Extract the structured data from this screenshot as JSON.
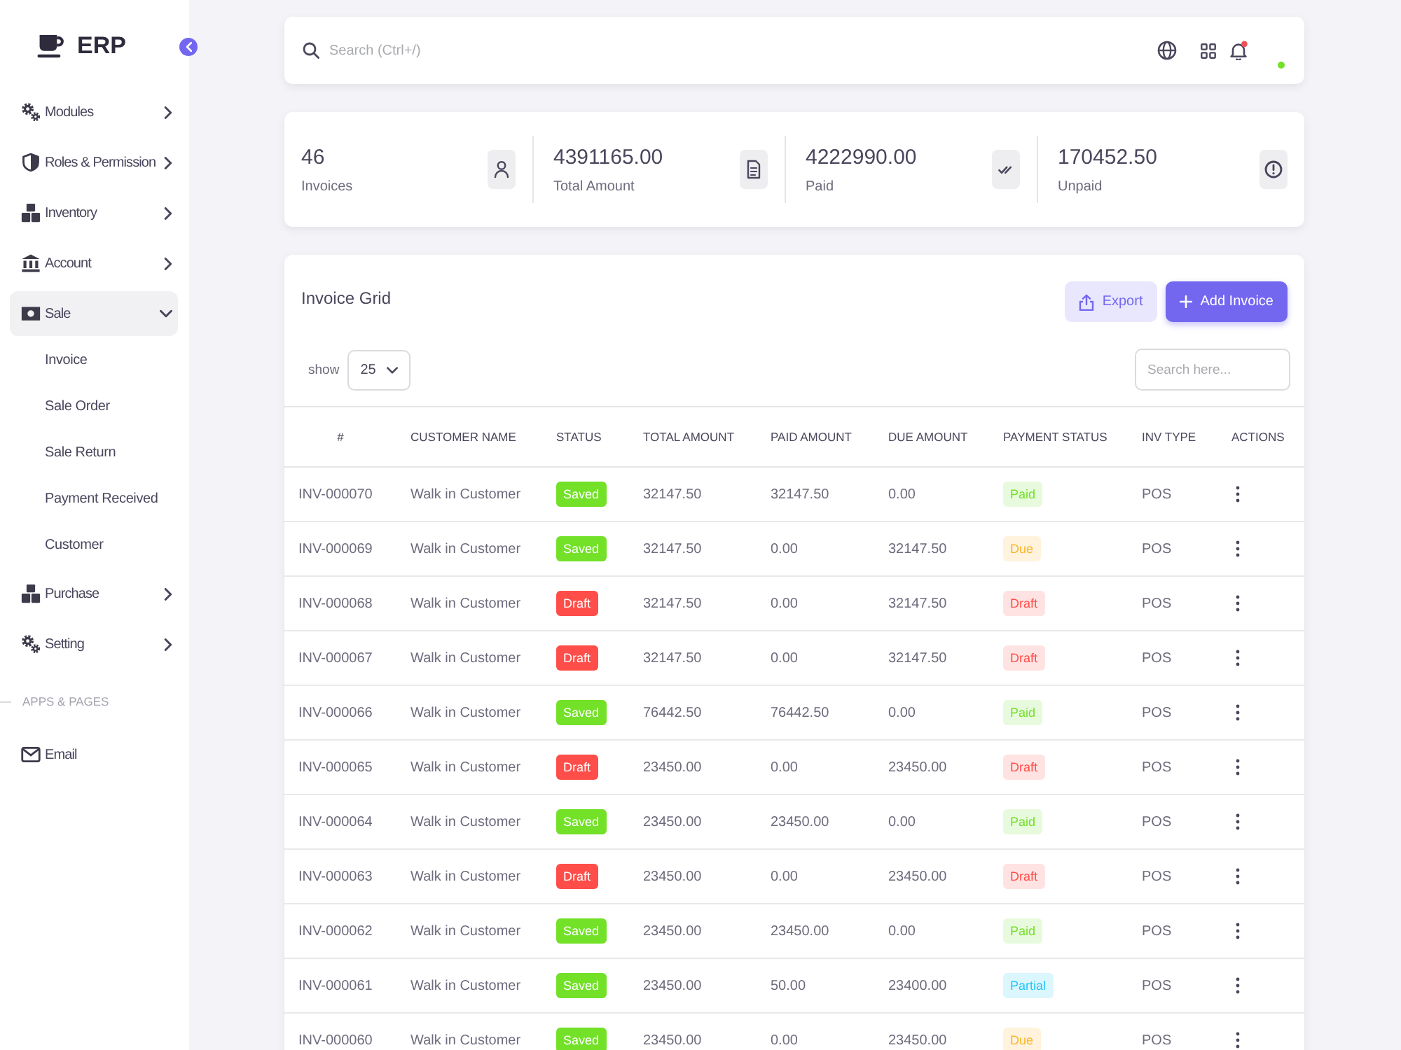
{
  "sidebar": {
    "logo": "ERP",
    "menu": [
      {
        "label": "Modules",
        "expanded": false
      },
      {
        "label": "Roles & Permission",
        "expanded": false
      },
      {
        "label": "Inventory",
        "expanded": false
      },
      {
        "label": "Account",
        "expanded": false
      },
      {
        "label": "Sale",
        "expanded": true,
        "children": [
          {
            "label": "Invoice"
          },
          {
            "label": "Sale Order"
          },
          {
            "label": "Sale Return"
          },
          {
            "label": "Payment Received"
          },
          {
            "label": "Customer"
          }
        ]
      },
      {
        "label": "Purchase",
        "expanded": false
      },
      {
        "label": "Setting",
        "expanded": false
      }
    ],
    "sections": [
      {
        "title": "APPS & PAGES",
        "items": [
          {
            "label": "Email"
          }
        ]
      }
    ]
  },
  "topbar": {
    "search": {
      "placeholder": "Search (Ctrl+/)"
    }
  },
  "stats": [
    {
      "value": "46",
      "label": "Invoices"
    },
    {
      "value": "4391165.00",
      "label": "Total Amount"
    },
    {
      "value": "4222990.00",
      "label": "Paid"
    },
    {
      "value": "170452.50",
      "label": "Unpaid"
    }
  ],
  "invoice_grid": {
    "title": "Invoice Grid",
    "buttons": [
      {
        "label": "Export",
        "kind": "secondary"
      },
      {
        "label": "Add Invoice",
        "kind": "primary"
      }
    ],
    "page_size": {
      "label": "show",
      "value": "25"
    },
    "search": {
      "placeholder": "Search here..."
    },
    "table": {
      "columns": [
        "#",
        "CUSTOMER NAME",
        "STATUS",
        "TOTAL AMOUNT",
        "PAID AMOUNT",
        "DUE AMOUNT",
        "PAYMENT STATUS",
        "INV TYPE",
        "ACTIONS"
      ],
      "rows": [
        {
          "number": "INV-000070",
          "customer": "Walk in Customer",
          "status": {
            "text": "Saved",
            "color": "#72e128"
          },
          "total": "32147.50",
          "paid": "32147.50",
          "due": "0.00",
          "payment_status": {
            "text": "Paid",
            "color": "#72e128"
          },
          "inv_type": "POS"
        },
        {
          "number": "INV-000069",
          "customer": "Walk in Customer",
          "status": {
            "text": "Saved",
            "color": "#72e128"
          },
          "total": "32147.50",
          "paid": "0.00",
          "due": "32147.50",
          "payment_status": {
            "text": "Due",
            "color": "#fdb528"
          },
          "inv_type": "POS"
        },
        {
          "number": "INV-000068",
          "customer": "Walk in Customer",
          "status": {
            "text": "Draft",
            "color": "#ff4d49"
          },
          "total": "32147.50",
          "paid": "0.00",
          "due": "32147.50",
          "payment_status": {
            "text": "Draft",
            "color": "#ff4d49"
          },
          "inv_type": "POS"
        },
        {
          "number": "INV-000067",
          "customer": "Walk in Customer",
          "status": {
            "text": "Draft",
            "color": "#ff4d49"
          },
          "total": "32147.50",
          "paid": "0.00",
          "due": "32147.50",
          "payment_status": {
            "text": "Draft",
            "color": "#ff4d49"
          },
          "inv_type": "POS"
        },
        {
          "number": "INV-000066",
          "customer": "Walk in Customer",
          "status": {
            "text": "Saved",
            "color": "#72e128"
          },
          "total": "76442.50",
          "paid": "76442.50",
          "due": "0.00",
          "payment_status": {
            "text": "Paid",
            "color": "#72e128"
          },
          "inv_type": "POS"
        },
        {
          "number": "INV-000065",
          "customer": "Walk in Customer",
          "status": {
            "text": "Draft",
            "color": "#ff4d49"
          },
          "total": "23450.00",
          "paid": "0.00",
          "due": "23450.00",
          "payment_status": {
            "text": "Draft",
            "color": "#ff4d49"
          },
          "inv_type": "POS"
        },
        {
          "number": "INV-000064",
          "customer": "Walk in Customer",
          "status": {
            "text": "Saved",
            "color": "#72e128"
          },
          "total": "23450.00",
          "paid": "23450.00",
          "due": "0.00",
          "payment_status": {
            "text": "Paid",
            "color": "#72e128"
          },
          "inv_type": "POS"
        },
        {
          "number": "INV-000063",
          "customer": "Walk in Customer",
          "status": {
            "text": "Draft",
            "color": "#ff4d49"
          },
          "total": "23450.00",
          "paid": "0.00",
          "due": "23450.00",
          "payment_status": {
            "text": "Draft",
            "color": "#ff4d49"
          },
          "inv_type": "POS"
        },
        {
          "number": "INV-000062",
          "customer": "Walk in Customer",
          "status": {
            "text": "Saved",
            "color": "#72e128"
          },
          "total": "23450.00",
          "paid": "23450.00",
          "due": "0.00",
          "payment_status": {
            "text": "Paid",
            "color": "#72e128"
          },
          "inv_type": "POS"
        },
        {
          "number": "INV-000061",
          "customer": "Walk in Customer",
          "status": {
            "text": "Saved",
            "color": "#72e128"
          },
          "total": "23450.00",
          "paid": "50.00",
          "due": "23400.00",
          "payment_status": {
            "text": "Partial",
            "color": "#26c6f9"
          },
          "inv_type": "POS"
        },
        {
          "number": "INV-000060",
          "customer": "Walk in Customer",
          "status": {
            "text": "Saved",
            "color": "#72e128"
          },
          "total": "23450.00",
          "paid": "0.00",
          "due": "23450.00",
          "payment_status": {
            "text": "Due",
            "color": "#fdb528"
          },
          "inv_type": "POS"
        }
      ]
    }
  }
}
